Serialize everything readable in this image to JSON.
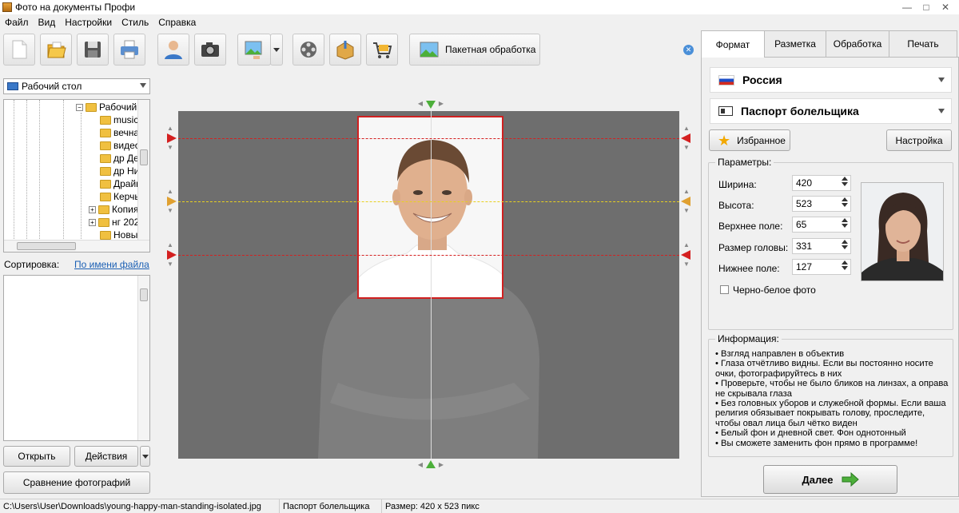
{
  "window": {
    "title": "Фото на документы Профи"
  },
  "menu": [
    "Файл",
    "Вид",
    "Настройки",
    "Стиль",
    "Справка"
  ],
  "toolbar": {
    "icons": [
      "new-file-icon",
      "open-folder-icon",
      "save-icon",
      "print-icon",
      "user-photo-icon",
      "camera-icon",
      "image-edit-icon",
      "film-icon",
      "box-upload-icon",
      "shopping-cart-icon"
    ],
    "batch_label": "Пакетная обработка"
  },
  "left": {
    "location": "Рабочий стол",
    "tree_root": "Рабочий",
    "tree_items": [
      "music",
      "вечна",
      "видео",
      "др Де",
      "др Ни",
      "Драйв",
      "Керчь",
      "Копия",
      "нг 202",
      "Новы"
    ],
    "sort_label": "Сортировка:",
    "sort_value": "По имени файла",
    "open_btn": "Открыть",
    "actions_btn": "Действия",
    "compare_btn": "Сравнение фотографий"
  },
  "right": {
    "tabs": [
      "Формат",
      "Разметка",
      "Обработка",
      "Печать"
    ],
    "active_tab": "Формат",
    "country": "Россия",
    "document": "Паспорт болельщика",
    "favorites_btn": "Избранное",
    "settings_btn": "Настройка",
    "params_label": "Параметры:",
    "params": [
      {
        "label": "Ширина:",
        "value": "420"
      },
      {
        "label": "Высота:",
        "value": "523"
      },
      {
        "label": "Верхнее поле:",
        "value": "65"
      },
      {
        "label": "Размер головы:",
        "value": "331"
      },
      {
        "label": "Нижнее поле:",
        "value": "127"
      }
    ],
    "bw_label": "Черно-белое фото",
    "info_label": "Информация:",
    "info": [
      "• Взгляд направлен в объектив",
      "• Глаза отчётливо видны. Если вы постоянно носите очки, фотографируйтесь в них",
      "• Проверьте, чтобы не было бликов на линзах, а оправа не скрывала глаза",
      "• Без головных уборов и служебной формы. Если ваша религия обязывает покрывать голову, проследите, чтобы овал лица был чётко виден",
      "• Белый фон и дневной свет. Фон однотонный",
      "• Вы сможете заменить фон прямо в программе!"
    ],
    "next_btn": "Далее"
  },
  "status": {
    "path": "C:\\Users\\User\\Downloads\\young-happy-man-standing-isolated.jpg",
    "doc": "Паспорт болельщика",
    "size": "Размер: 420 x 523 пикс"
  },
  "colors": {
    "guide_red": "#d42020",
    "guide_yellow": "#e8d020",
    "accent_green": "#4caf3a"
  }
}
